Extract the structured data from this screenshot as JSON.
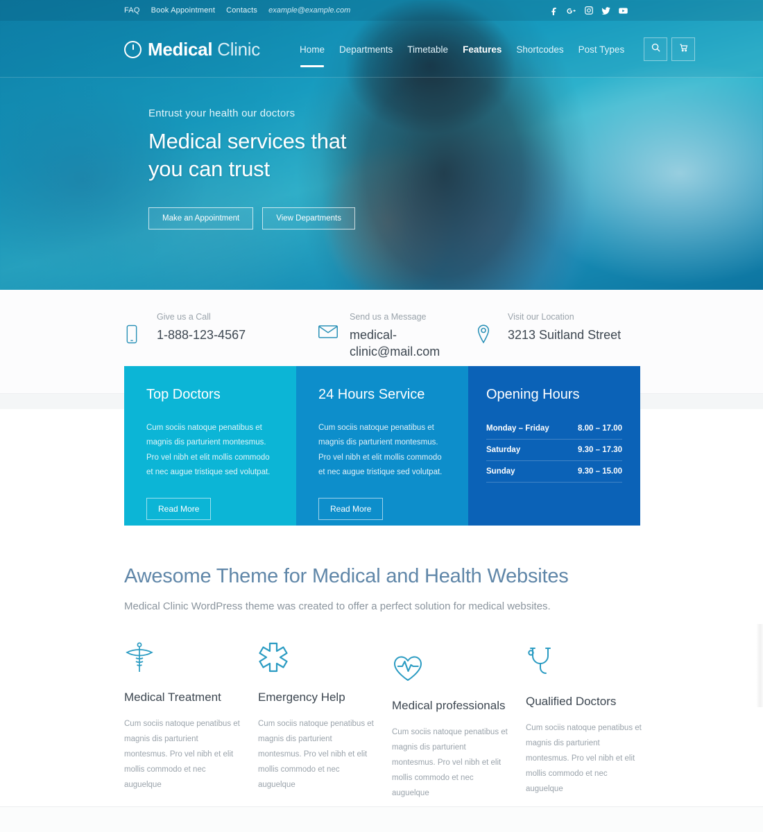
{
  "topbar": {
    "links": [
      {
        "label": "FAQ"
      },
      {
        "label": "Book Appointment"
      },
      {
        "label": "Contacts"
      }
    ],
    "email": "example@example.com",
    "social": [
      {
        "name": "facebook-icon",
        "label": "f"
      },
      {
        "name": "google-plus-icon",
        "label": "g+"
      },
      {
        "name": "instagram-icon",
        "label": "ig"
      },
      {
        "name": "twitter-icon",
        "label": "tw"
      },
      {
        "name": "youtube-icon",
        "label": "yt"
      }
    ]
  },
  "brand": {
    "name_bold": "Medical",
    "name_light": "Clinic",
    "mark": "clinic-logo-icon"
  },
  "nav": {
    "items": [
      {
        "label": "Home",
        "active": false
      },
      {
        "label": "Departments",
        "active": false
      },
      {
        "label": "Timetable",
        "active": false
      },
      {
        "label": "Features",
        "active": true
      },
      {
        "label": "Shortcodes",
        "active": false
      },
      {
        "label": "Post Types",
        "active": false
      }
    ],
    "search_icon": "search-icon",
    "cart_icon": "shopping-cart-icon"
  },
  "hero": {
    "kicker": "Entrust your health our doctors",
    "title_line1": "Medical services that",
    "title_line2": "you can trust",
    "primary_button": "Make an Appointment",
    "secondary_button": "View Departments"
  },
  "contact": {
    "items": [
      {
        "icon": "phone-icon",
        "label": "Give us a Call",
        "value": "1-888-123-4567"
      },
      {
        "icon": "envelope-icon",
        "label": "Send us a Message",
        "value": "medical-clinic@mail.com"
      },
      {
        "icon": "map-pin-icon",
        "label": "Visit our Location",
        "value": "3213 Suitland Street"
      }
    ]
  },
  "cards": {
    "top_doctors": {
      "title": "Top Doctors",
      "text": "Cum sociis natoque penatibus et magnis dis parturient montesmus. Pro vel nibh et elit mollis commodo et nec augue tristique sed volutpat.",
      "button": "Read More",
      "color": "#0cb5d6"
    },
    "service_24h": {
      "title": "24 Hours Service",
      "text": "Cum sociis natoque penatibus et magnis dis parturient montesmus. Pro vel nibh et elit mollis commodo et nec augue tristique sed volutpat.",
      "button": "Read More",
      "color": "#0d8ecb"
    },
    "opening_hours": {
      "title": "Opening Hours",
      "color": "#0b62b7",
      "rows": [
        {
          "day": "Monday – Friday",
          "time": "8.00 – 17.00"
        },
        {
          "day": "Saturday",
          "time": "9.30 – 17.30"
        },
        {
          "day": "Sunday",
          "time": "9.30 – 15.00"
        }
      ]
    }
  },
  "awesome": {
    "title": "Awesome Theme for Medical and Health Websites",
    "subtitle": "Medical Clinic WordPress theme was created to offer a perfect solution for medical websites."
  },
  "features": [
    {
      "icon": "caduceus-icon",
      "title": "Medical Treatment",
      "text": "Cum sociis natoque penatibus et magnis dis parturient montesmus. Pro vel nibh et elit mollis commodo et nec auguelque"
    },
    {
      "icon": "star-of-life-icon",
      "title": "Emergency Help",
      "text": "Cum sociis natoque penatibus et magnis dis parturient montesmus. Pro vel nibh et elit mollis commodo et nec auguelque"
    },
    {
      "icon": "heart-pulse-icon",
      "title": "Medical professionals",
      "text": "Cum sociis natoque penatibus et magnis dis parturient montesmus. Pro vel nibh et elit mollis commodo et nec auguelque"
    },
    {
      "icon": "stethoscope-icon",
      "title": "Qualified Doctors",
      "text": "Cum sociis natoque penatibus et magnis dis parturient montesmus. Pro vel nibh et elit mollis commodo et nec auguelque"
    }
  ],
  "theme": {
    "accent_cyan": "#0cb5d6",
    "accent_blue": "#0d8ecb",
    "accent_deep_blue": "#0b62b7",
    "icon_teal": "#2a9bc2",
    "heading_blue": "#5f86a8"
  }
}
